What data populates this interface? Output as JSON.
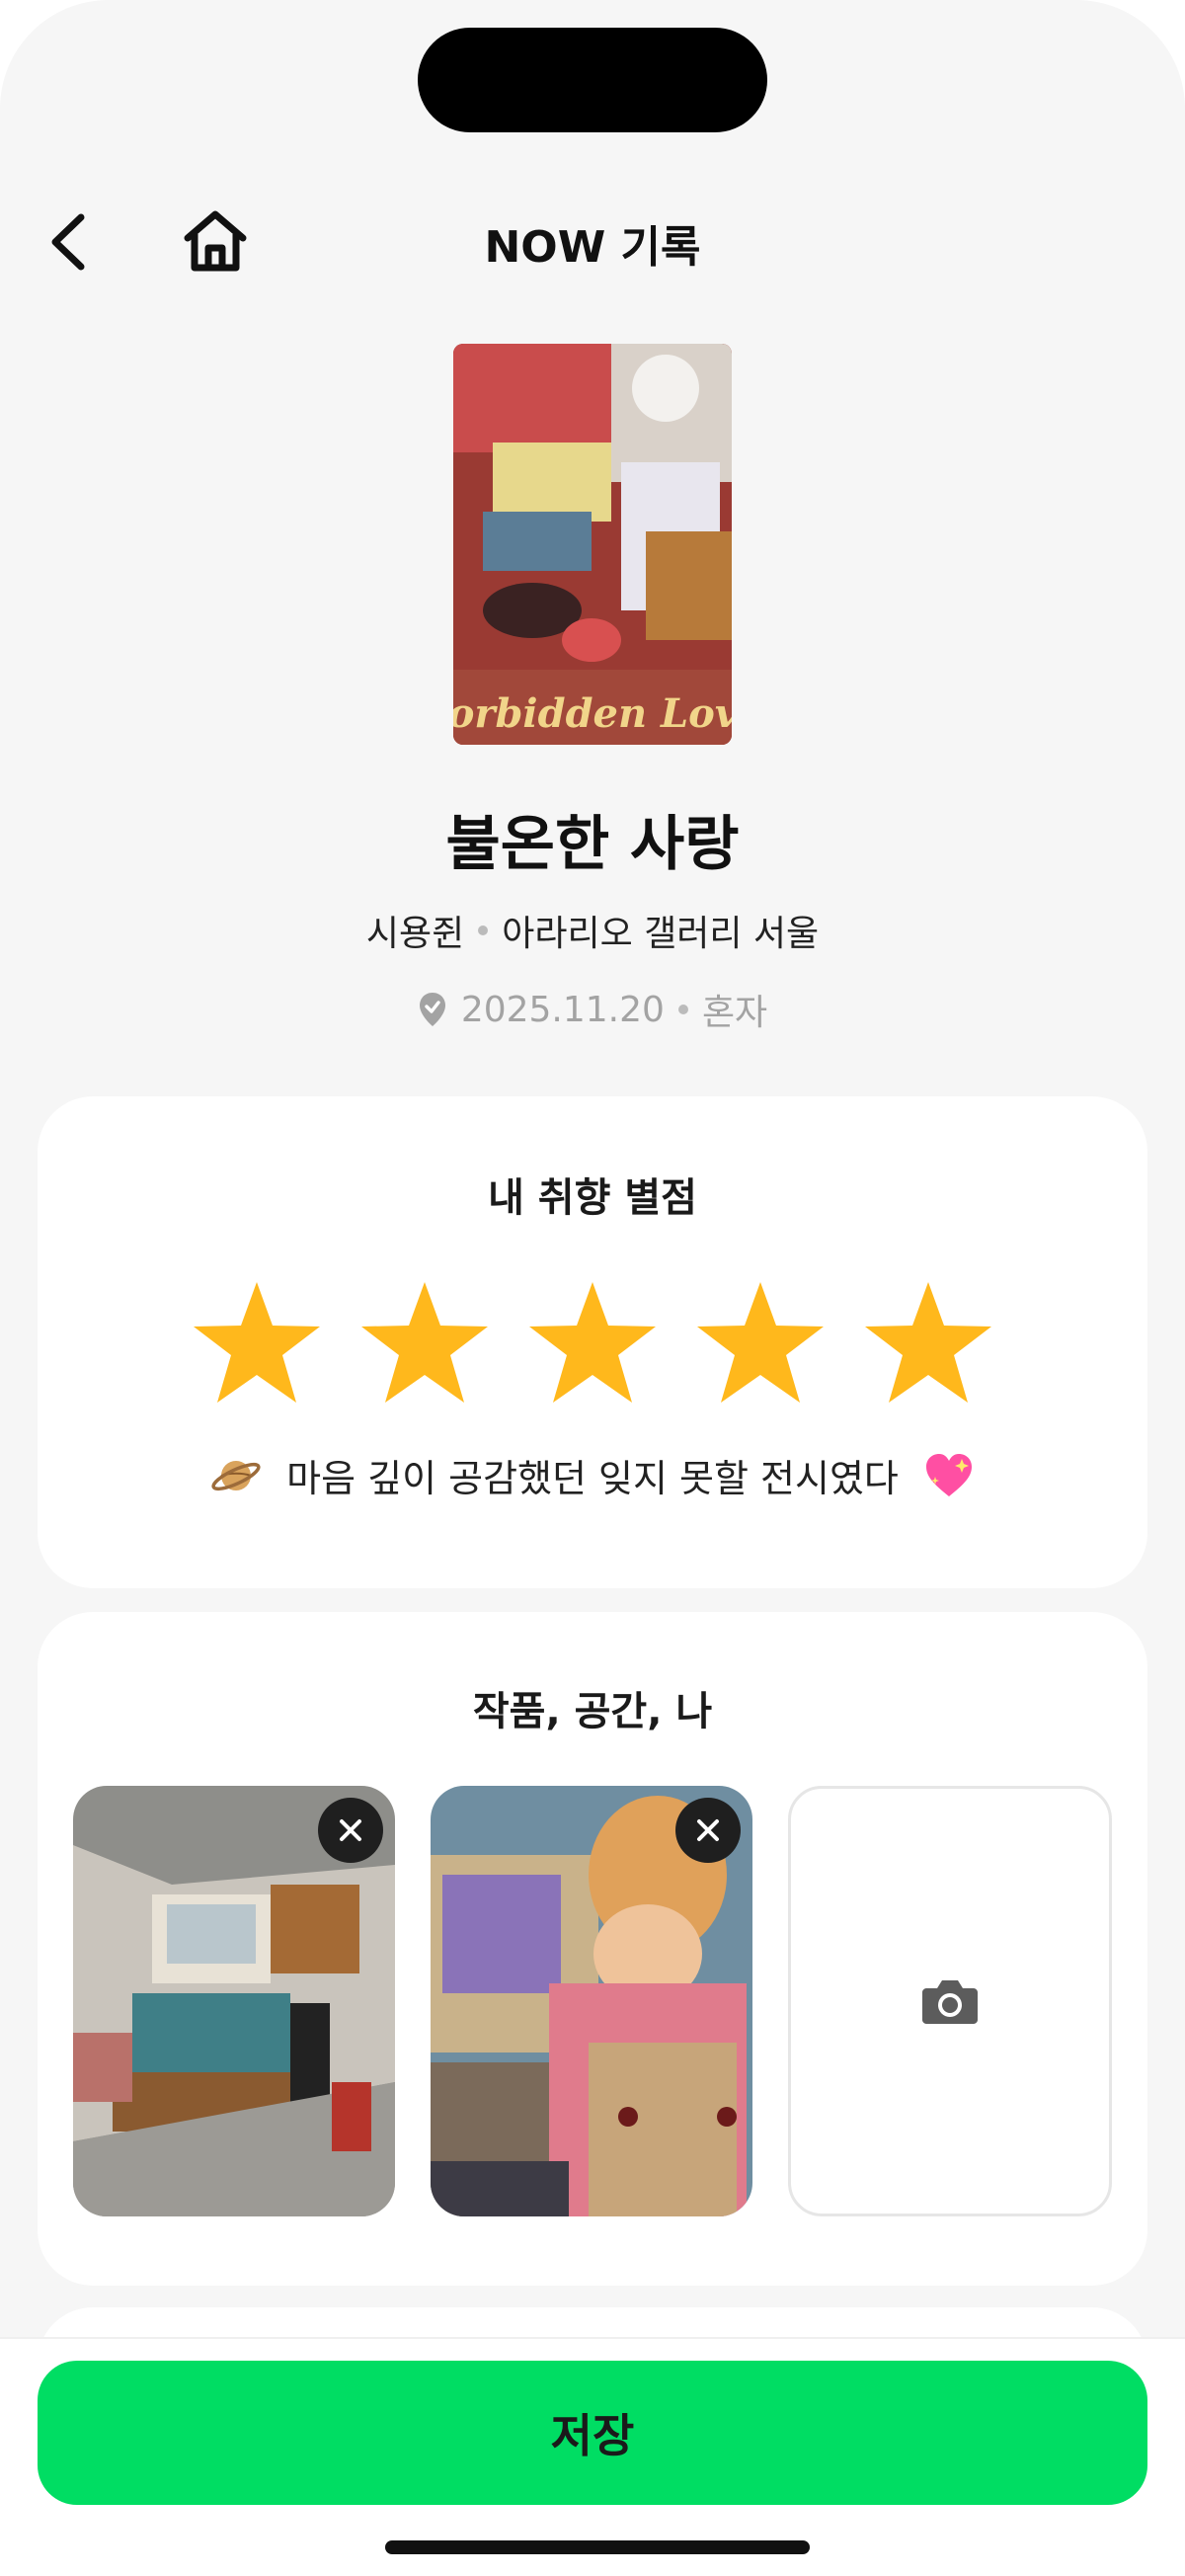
{
  "header": {
    "title": "NOW 기록",
    "back_icon": "chevron-left-icon",
    "home_icon": "home-icon"
  },
  "exhibition": {
    "title": "불온한 사랑",
    "artist": "시용쥔",
    "venue": "아라리오 갤러리 서울",
    "date": "2025.11.20",
    "companion": "혼자",
    "poster_text": "Forbidden Love"
  },
  "rating_card": {
    "title": "내 취향 별점",
    "rating": 5,
    "max_rating": 5,
    "star_color": "#FFB81C",
    "comment": "마음 깊이 공감했던 잊지 못할 전시였다",
    "leading_emoji": "saturn-emoji",
    "trailing_emoji": "sparkling-heart-emoji"
  },
  "photos_card": {
    "title": "작품, 공간, 나",
    "photos": [
      {
        "name": "photo-kitchen-diorama"
      },
      {
        "name": "photo-figure-with-tv"
      }
    ],
    "add_icon": "camera-icon"
  },
  "footer": {
    "save_label": "저장",
    "accent": "#00DD63"
  }
}
